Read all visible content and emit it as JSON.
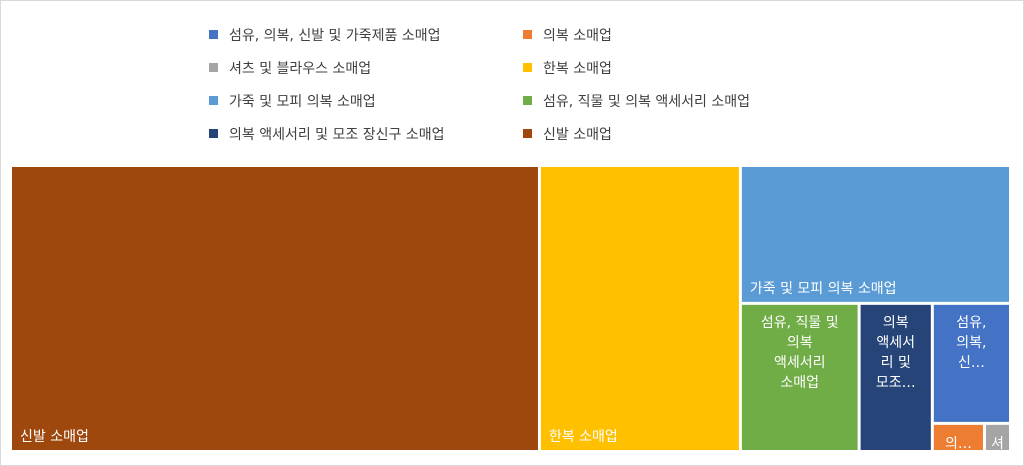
{
  "chart_data": {
    "type": "treemap",
    "title": "",
    "series": [
      {
        "name": "섬유, 의복, 신발 및 가죽제품 소매업",
        "color": "#4472c4",
        "value": 3.2,
        "label_lines": [
          "섬유,",
          "의복,",
          "신…"
        ]
      },
      {
        "name": "의복 소매업",
        "color": "#ed7d31",
        "value": 0.5,
        "label_lines": [
          "의…"
        ]
      },
      {
        "name": "셔츠 및 블라우스 소매업",
        "color": "#a5a5a5",
        "value": 0.25,
        "label_lines": [
          "셔"
        ]
      },
      {
        "name": "한복 소매업",
        "color": "#ffc000",
        "value": 19.6,
        "label_lines": [
          "한복 소매업"
        ]
      },
      {
        "name": "가죽 및 모피 의복 소매업",
        "color": "#5b9bd5",
        "value": 12.7,
        "label_lines": [
          "가죽 및 모피 의복 소매업"
        ]
      },
      {
        "name": "섬유, 직물 및 의복 액세서리 소매업",
        "color": "#70ad47",
        "value": 6.0,
        "label_lines": [
          "섬유, 직물 및",
          "의복",
          "액세서리",
          "소매업"
        ]
      },
      {
        "name": "의복 액세서리 및 모조 장신구 소매업",
        "color": "#264478",
        "value": 3.7,
        "label_lines": [
          "의복",
          "액세서",
          "리 및",
          "모조…"
        ]
      },
      {
        "name": "신발 소매업",
        "color": "#9e480e",
        "value": 51.6,
        "label_lines": [
          "신발 소매업"
        ]
      }
    ],
    "legend_placement": "top"
  }
}
